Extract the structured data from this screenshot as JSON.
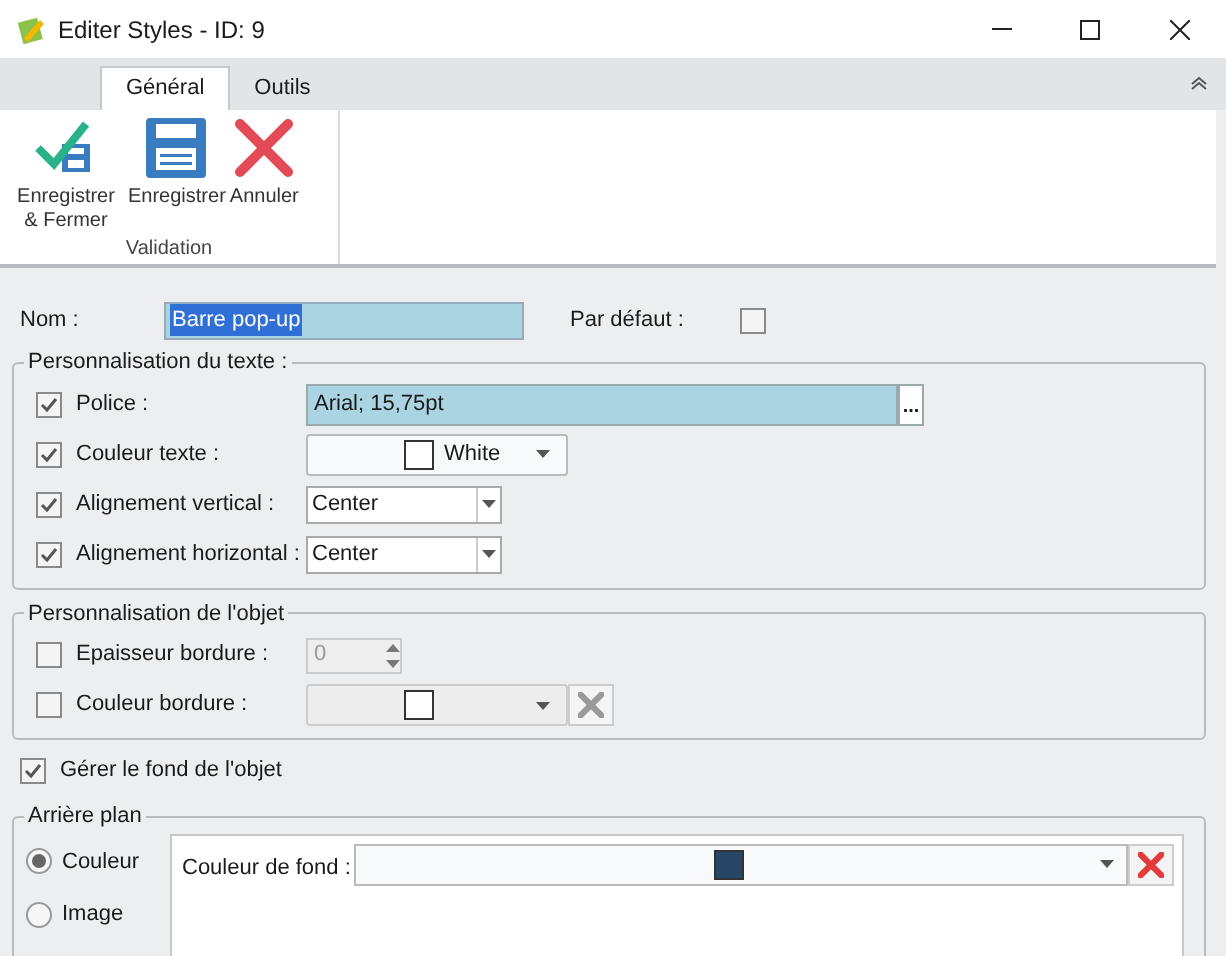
{
  "window": {
    "title": "Editer Styles - ID: 9"
  },
  "tabs": [
    {
      "label": "Général",
      "selected": true
    },
    {
      "label": "Outils",
      "selected": false
    }
  ],
  "ribbon": {
    "buttons": [
      {
        "kind": "save_close",
        "label": "Enregistrer & Fermer"
      },
      {
        "kind": "save",
        "label": "Enregistrer"
      },
      {
        "kind": "cancel",
        "label": "Annuler"
      }
    ],
    "group_label": "Validation"
  },
  "name": {
    "label": "Nom :",
    "value": "Barre pop-up"
  },
  "default": {
    "label": "Par défaut :",
    "checked": false
  },
  "text_group": {
    "title": "Personnalisation du texte :",
    "rows": [
      {
        "kind": "font",
        "label": "Police :",
        "checked": true,
        "value": "Arial; 15,75pt",
        "button": "..."
      },
      {
        "kind": "color",
        "label": "Couleur texte :",
        "checked": true,
        "value": "White",
        "color": "#ffffff"
      },
      {
        "kind": "select",
        "label": "Alignement vertical :",
        "checked": true,
        "value": "Center"
      },
      {
        "kind": "select",
        "label": "Alignement horizontal :",
        "checked": true,
        "value": "Center"
      }
    ]
  },
  "object_group": {
    "title": "Personnalisation de l'objet",
    "rows": [
      {
        "kind": "spin",
        "label": "Epaisseur bordure :",
        "checked": false,
        "value": "0"
      },
      {
        "kind": "color_clear",
        "label": "Couleur bordure :",
        "checked": false,
        "color": "#ffffff"
      }
    ]
  },
  "manage_background": {
    "label": "Gérer le fond de l'objet",
    "checked": true
  },
  "background_group": {
    "title": "Arrière plan",
    "options": [
      {
        "label": "Couleur",
        "selected": true
      },
      {
        "label": "Image",
        "selected": false
      }
    ],
    "color_field": {
      "label": "Couleur de fond :",
      "color": "#284766"
    }
  }
}
